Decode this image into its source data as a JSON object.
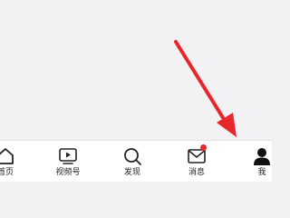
{
  "tabbar": {
    "tabs": [
      {
        "label": "首页",
        "icon": "home-icon",
        "active": false
      },
      {
        "label": "视频号",
        "icon": "video-channel-icon",
        "active": false
      },
      {
        "label": "发现",
        "icon": "search-icon",
        "active": false
      },
      {
        "label": "消息",
        "icon": "mail-icon",
        "active": false,
        "badge": "red-dot"
      },
      {
        "label": "我",
        "icon": "person-icon",
        "active": true
      }
    ]
  },
  "colors": {
    "background": "#f2f1f3",
    "tabbar": "#ffffff",
    "icon": "#222222",
    "badge": "#e8262b",
    "annotation_arrow": "#e8262b"
  },
  "annotation": {
    "type": "arrow",
    "points_to": "tab-me"
  }
}
